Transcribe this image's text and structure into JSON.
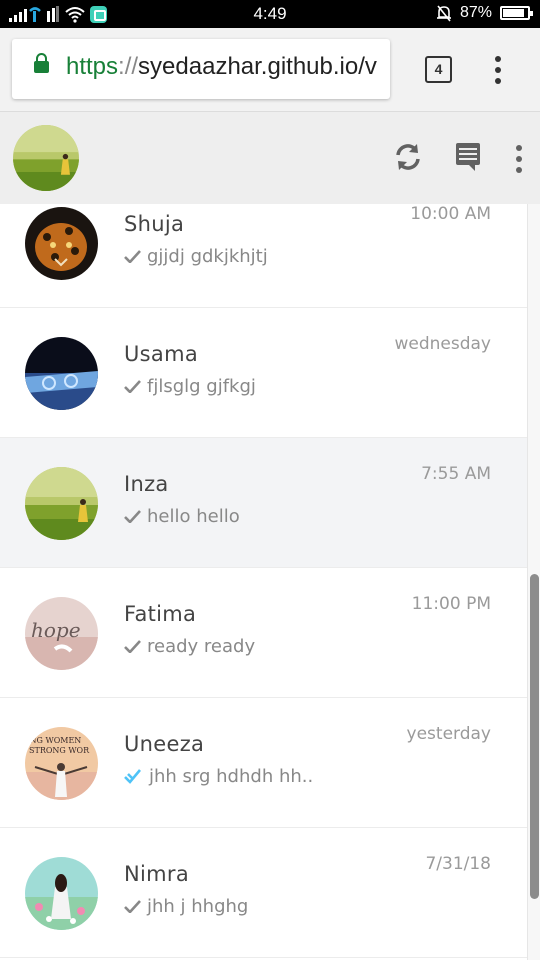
{
  "status_bar": {
    "time": "4:49",
    "battery_text": "87%",
    "battery_level": 0.87
  },
  "browser": {
    "url_scheme": "https",
    "url_separator": "://",
    "url_host": "syedaazhar.github.io/v",
    "tab_count": "4"
  },
  "header": {
    "actions": [
      "refresh-icon",
      "new-chat-icon",
      "more-vertical-icon"
    ]
  },
  "chats": [
    {
      "name": "Shuja",
      "message": "gjjdj gdkjkhjtj",
      "time": "10:00 AM",
      "status": "sent"
    },
    {
      "name": "Usama",
      "message": "fjlsglg gjfkgj",
      "time": "wednesday",
      "status": "sent"
    },
    {
      "name": "Inza",
      "message": "hello hello",
      "time": "7:55 AM",
      "status": "sent",
      "active": true
    },
    {
      "name": "Fatima",
      "message": "ready ready",
      "time": "11:00 PM",
      "status": "sent"
    },
    {
      "name": "Uneeza",
      "message": "jhh srg hdhdh hh..",
      "time": "yesterday",
      "status": "read",
      "avatar_text": [
        "ONG WOMEN",
        "STRONG WOR"
      ]
    },
    {
      "name": "Nimra",
      "message": "jhh j hhghg",
      "time": "7/31/18",
      "status": "sent"
    }
  ],
  "fatima_avatar_text": "hope",
  "colors": {
    "secure_green": "#188038",
    "read_tick": "#4fc3f7",
    "sent_tick": "#888888",
    "header_bg": "#eeeeee",
    "active_row": "#f3f4f6"
  },
  "scroll": {
    "thumb_start_fraction": 0.49,
    "thumb_length_fraction": 0.43
  }
}
